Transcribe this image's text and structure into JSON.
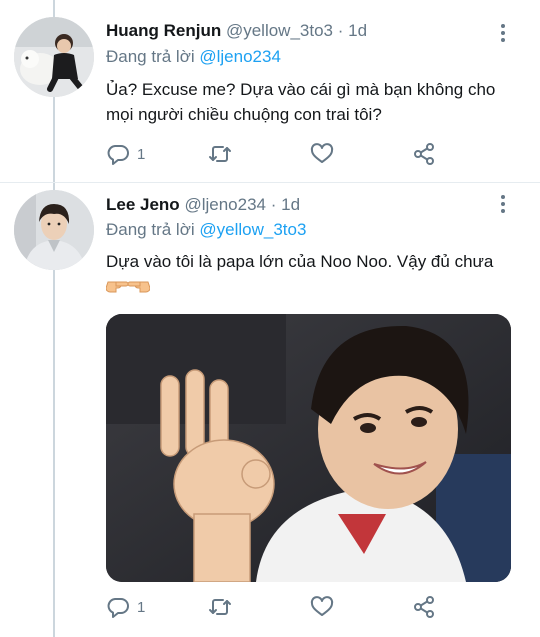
{
  "tweets": [
    {
      "author_name": "Huang Renjun",
      "author_handle": "@yellow_3to3",
      "separator": "·",
      "time": "1d",
      "replying_prefix": "Đang trả lời",
      "replying_to": "@ljeno234",
      "text": "Ủa? Excuse me? Dựa vào cái gì mà bạn không cho mọi người chiều chuộng con trai tôi?",
      "reply_count": "1",
      "retweet_count": "",
      "like_count": ""
    },
    {
      "author_name": "Lee Jeno",
      "author_handle": "@ljeno234",
      "separator": "·",
      "time": "1d",
      "replying_prefix": "Đang trả lời",
      "replying_to": "@yellow_3to3",
      "text": "Dựa vào tôi là papa lớn của Noo Noo. Vậy đủ chưa",
      "text_emoji": "pointing-hands-emoji",
      "reply_count": "1",
      "retweet_count": "",
      "like_count": ""
    }
  ],
  "colors": {
    "accent": "#1da1f2",
    "muted": "#657786",
    "text": "#14171a",
    "thread_line": "#ccd6dd"
  },
  "icons": [
    "more-vertical-icon",
    "reply-icon",
    "retweet-icon",
    "like-icon",
    "share-icon"
  ]
}
